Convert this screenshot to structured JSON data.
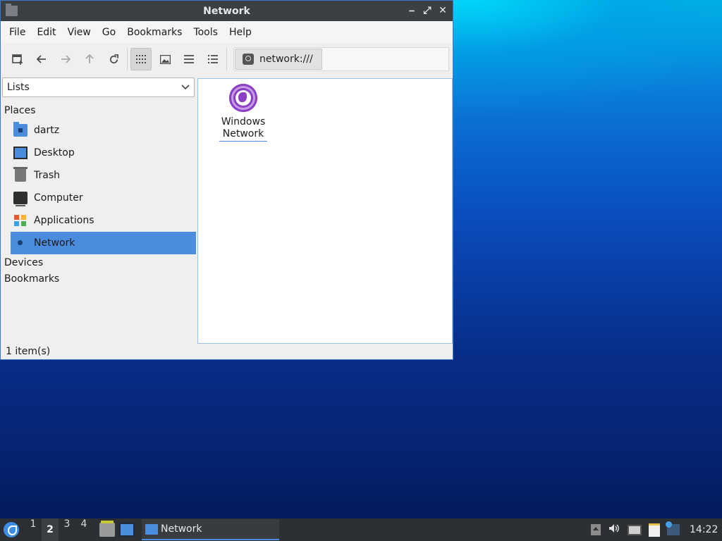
{
  "window": {
    "title": "Network",
    "controls": {
      "minimize": "⎯",
      "maximize": "⤢",
      "close": "✕"
    }
  },
  "menubar": [
    "File",
    "Edit",
    "View",
    "Go",
    "Bookmarks",
    "Tools",
    "Help"
  ],
  "toolbar": {
    "icons": [
      "new-tab-icon",
      "back-arrow-icon",
      "forward-arrow-icon",
      "up-arrow-icon",
      "reload-icon",
      "icon-view-icon",
      "thumbnail-view-icon",
      "compact-view-icon",
      "detailed-list-icon"
    ],
    "location": "network:///"
  },
  "sidepane": {
    "selector": "Lists",
    "sections": {
      "places": "Places",
      "devices": "Devices",
      "bookmarks": "Bookmarks"
    },
    "places": [
      {
        "label": "dartz",
        "icon": "home-folder-icon"
      },
      {
        "label": "Desktop",
        "icon": "desktop-icon"
      },
      {
        "label": "Trash",
        "icon": "trash-icon"
      },
      {
        "label": "Computer",
        "icon": "computer-icon"
      },
      {
        "label": "Applications",
        "icon": "applications-icon"
      },
      {
        "label": "Network",
        "icon": "network-icon"
      }
    ]
  },
  "main": {
    "items": [
      {
        "line1": "Windows",
        "line2": "Network",
        "icon": "windows-network-icon"
      }
    ]
  },
  "status": "1 item(s)",
  "taskbar": {
    "workspaces": [
      "1",
      "2",
      "3",
      "4"
    ],
    "current_workspace": "2",
    "task": "Network",
    "clock": "14:22"
  },
  "colors": {
    "accent": "#4a8ddf",
    "titlebar": "#3a3f44",
    "taskbar": "#2c2f33",
    "network_icon": "#8a3fc4"
  }
}
